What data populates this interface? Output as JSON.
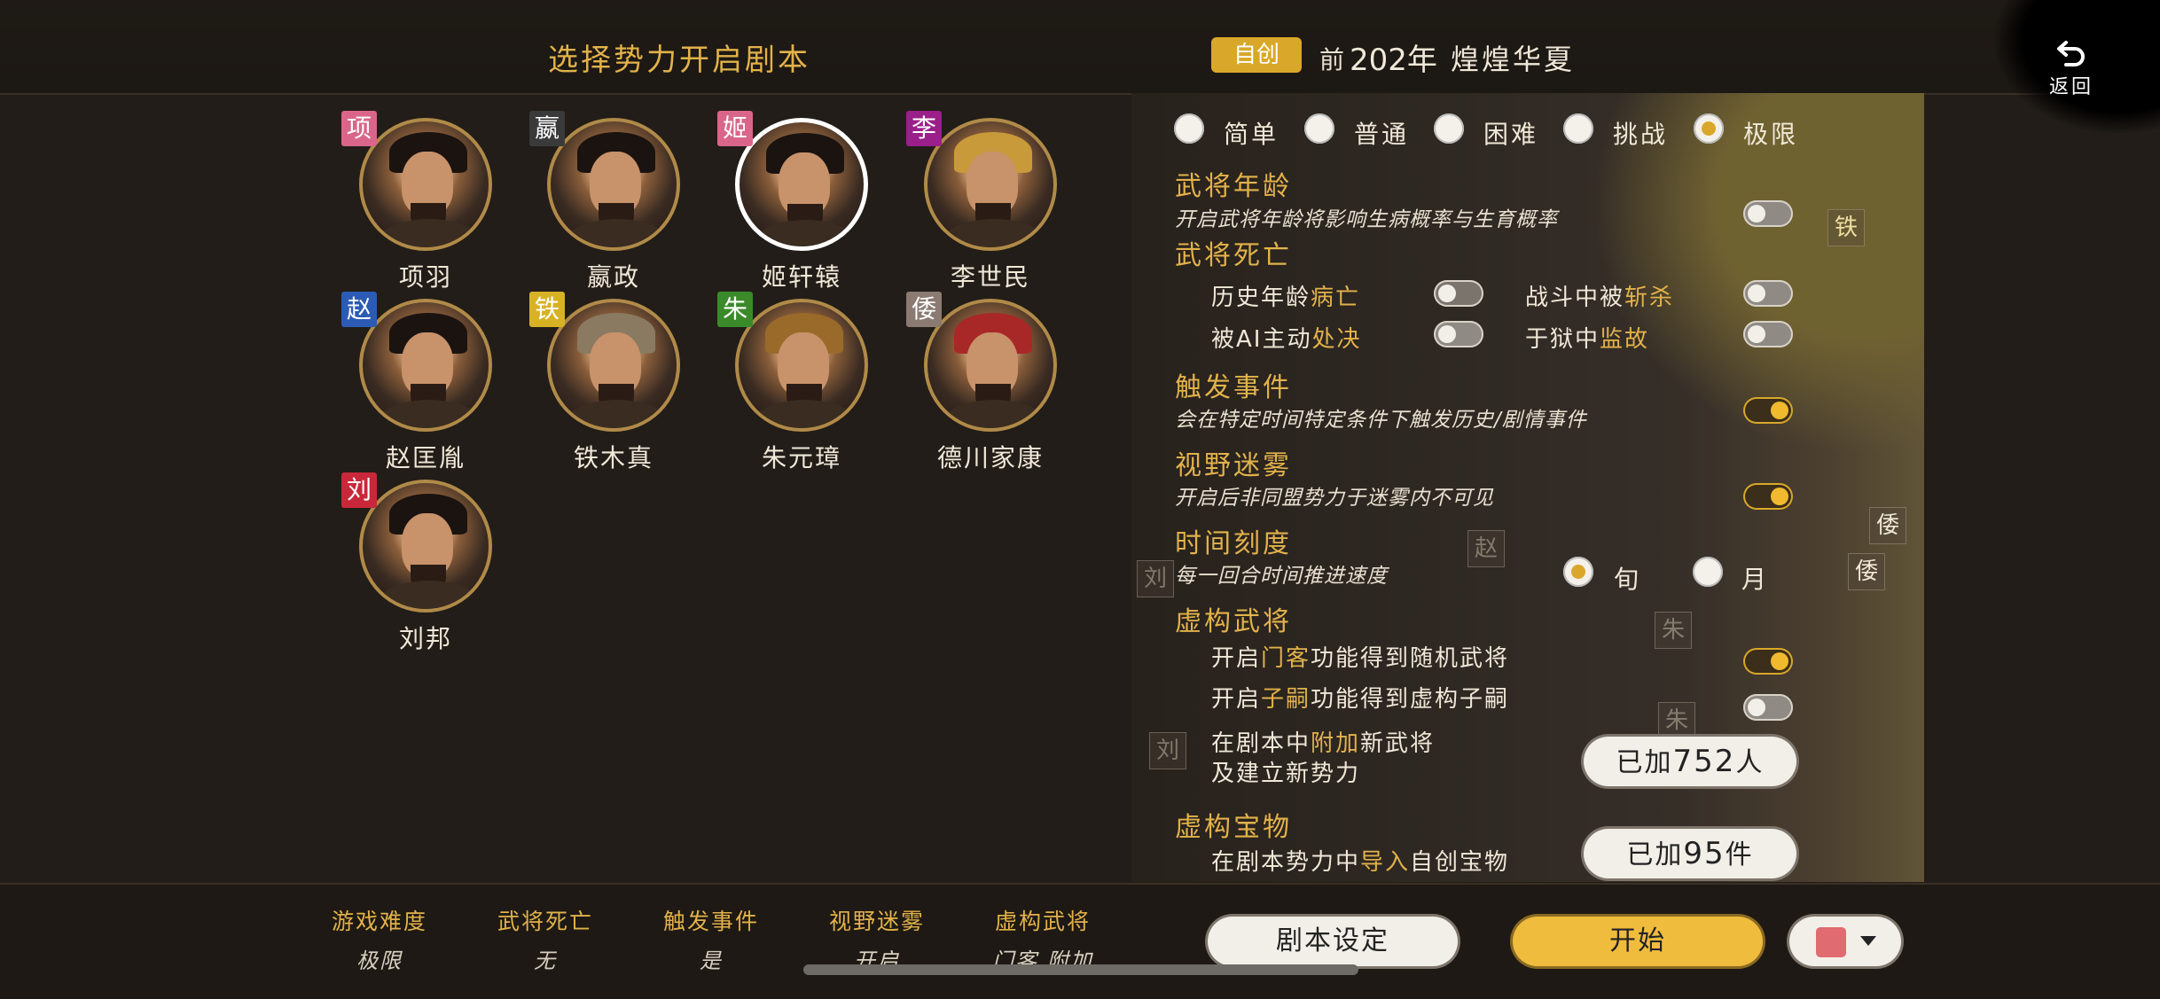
{
  "header": {
    "title": "选择势力开启剧本",
    "mode_badge": "自创",
    "year_prefix": "前",
    "year": "202年",
    "scenario": "煌煌华夏",
    "back_label": "返回"
  },
  "characters": [
    {
      "tag": "项",
      "tag_color": "#d9668a",
      "name": "项羽"
    },
    {
      "tag": "嬴",
      "tag_color": "#3a3a3a",
      "name": "嬴政"
    },
    {
      "tag": "姬",
      "tag_color": "#d9668a",
      "name": "姬轩辕",
      "selected": true
    },
    {
      "tag": "李",
      "tag_color": "#9a1f8a",
      "name": "李世民"
    },
    {
      "tag": "赵",
      "tag_color": "#2b5bb5",
      "name": "赵匡胤"
    },
    {
      "tag": "铁",
      "tag_color": "#d8b225",
      "name": "铁木真"
    },
    {
      "tag": "朱",
      "tag_color": "#3b8a2a",
      "name": "朱元璋"
    },
    {
      "tag": "倭",
      "tag_color": "#8a7a72",
      "name": "德川家康"
    },
    {
      "tag": "刘",
      "tag_color": "#c8283a",
      "name": "刘邦"
    }
  ],
  "difficulty": {
    "options": [
      "简单",
      "普通",
      "困难",
      "挑战",
      "极限"
    ],
    "selected": "极限"
  },
  "settings": {
    "age": {
      "title": "武将年龄",
      "desc": "开启武将年龄将影响生病概率与生育概率",
      "enabled": false
    },
    "death": {
      "title": "武将死亡",
      "history_a": "历史年龄",
      "history_b": "病亡",
      "history_on": false,
      "battle_a": "战斗中被",
      "battle_b": "斩杀",
      "battle_on": false,
      "ai_a": "被AI主动",
      "ai_b": "处决",
      "ai_on": false,
      "prison_a": "于狱中",
      "prison_b": "监故",
      "prison_on": false
    },
    "events": {
      "title": "触发事件",
      "desc": "会在特定时间特定条件下触发历史/剧情事件",
      "enabled": true
    },
    "fog": {
      "title": "视野迷雾",
      "desc": "开启后非同盟势力于迷雾内不可见",
      "enabled": true
    },
    "time": {
      "title": "时间刻度",
      "desc": "每一回合时间推进速度",
      "options": [
        "旬",
        "月"
      ],
      "selected": "旬"
    },
    "fictional": {
      "title": "虚构武将",
      "retainer_a": "开启",
      "retainer_b": "门客",
      "retainer_c": "功能得到随机武将",
      "retainer_on": true,
      "heir_a": "开启",
      "heir_b": "子嗣",
      "heir_c": "功能得到虚构子嗣",
      "heir_on": false,
      "add_line1_a": "在剧本中",
      "add_line1_b": "附加",
      "add_line1_c": "新武将",
      "add_line2": "及建立新势力",
      "added_prefix": "已加",
      "added_num": "752",
      "added_unit": "人"
    },
    "treasure": {
      "title": "虚构宝物",
      "line_a": "在剧本势力中",
      "line_b": "导入",
      "line_c": "自创宝物",
      "added_prefix": "已加",
      "added_num": "95",
      "added_unit": "件"
    }
  },
  "map_marks": [
    "铁",
    "倭",
    "倭",
    "刘",
    "赵",
    "刘",
    "朱",
    "朱"
  ],
  "summary": [
    {
      "label": "游戏难度",
      "value": "极限"
    },
    {
      "label": "武将死亡",
      "value": "无"
    },
    {
      "label": "触发事件",
      "value": "是"
    },
    {
      "label": "视野迷雾",
      "value": "开启"
    },
    {
      "label": "虚构武将",
      "value": "门客 附加"
    }
  ],
  "buttons": {
    "settings": "剧本设定",
    "start": "开始"
  },
  "faction_color": "#e06b70"
}
